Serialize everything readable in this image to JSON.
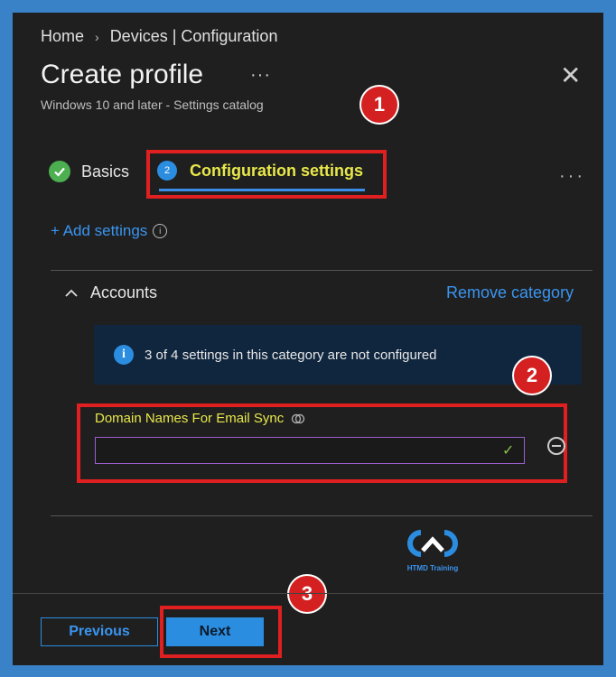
{
  "breadcrumb": {
    "home": "Home",
    "separator": "›",
    "current": "Devices | Configuration"
  },
  "header": {
    "title": "Create profile",
    "more": "···",
    "close": "✕",
    "subtitle": "Windows 10 and later - Settings catalog"
  },
  "tabs": [
    {
      "label": "Basics",
      "status": "completed"
    },
    {
      "label": "Configuration settings",
      "step": "2",
      "status": "active"
    }
  ],
  "tabs_more": "···",
  "add_settings": {
    "label": "+ Add settings",
    "info": "i"
  },
  "category": {
    "name": "Accounts",
    "remove_label": "Remove category"
  },
  "info_bar": {
    "icon": "i",
    "text": "3 of 4 settings in this category are not configured"
  },
  "field": {
    "label": "Domain Names For Email Sync",
    "value": "",
    "check": "✓"
  },
  "annotations": {
    "badge1": "1",
    "badge2": "2",
    "badge3": "3"
  },
  "logo": {
    "text": "HTMD Training"
  },
  "footer": {
    "previous": "Previous",
    "next": "Next"
  },
  "colors": {
    "accent": "#2b8de0",
    "highlight": "#e8e84a",
    "annotation": "#e02020",
    "panel": "#1f1f1f",
    "frame": "#3a82c8"
  }
}
